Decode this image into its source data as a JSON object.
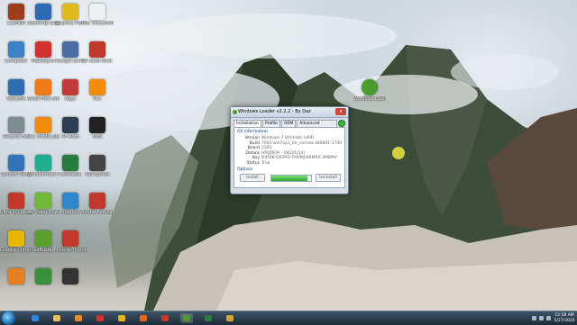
{
  "desktop": {
    "icons": [
      {
        "label": "123HDR",
        "color": "#9c3d1d",
        "col": 0,
        "row": 0
      },
      {
        "label": "Computer",
        "color": "#3b82c4",
        "col": 0,
        "row": 1
      },
      {
        "label": "Network",
        "color": "#2f6fb0",
        "col": 0,
        "row": 2
      },
      {
        "label": "Recycle Bin",
        "color": "#7f8c8d",
        "col": 0,
        "row": 3
      },
      {
        "label": "Control Panel",
        "color": "#3573b8",
        "col": 0,
        "row": 4
      },
      {
        "label": "Ultra CD Reader",
        "color": "#c0392b",
        "col": 0,
        "row": 5
      },
      {
        "label": "Google Chrome",
        "color": "#e8b800",
        "col": 0,
        "row": 6
      },
      {
        "label": "",
        "color": "#e67e22",
        "col": 0,
        "row": 7
      },
      {
        "label": "SketchUp Graphics Kit",
        "color": "#2d6bb5",
        "col": 1,
        "row": 0
      },
      {
        "label": "MEGAsync",
        "color": "#d0312d",
        "col": 1,
        "row": 1
      },
      {
        "label": "Avast Free Antivirus",
        "color": "#f07b16",
        "col": 1,
        "row": 2
      },
      {
        "label": "VLC media player",
        "color": "#f28c0f",
        "col": 1,
        "row": 3
      },
      {
        "label": "Wondershare Filmora",
        "color": "#1fae8f",
        "col": 1,
        "row": 4
      },
      {
        "label": "4K Video Downloader",
        "color": "#72b83b",
        "col": 1,
        "row": 5
      },
      {
        "label": "IsoBuster",
        "color": "#5aa02c",
        "col": 1,
        "row": 6
      },
      {
        "label": "",
        "color": "#3a8f3a",
        "col": 1,
        "row": 7
      },
      {
        "label": "Graphics PDF Tool",
        "color": "#e0b91c",
        "col": 2,
        "row": 0
      },
      {
        "label": "Google Earth",
        "color": "#4a6fa5",
        "col": 2,
        "row": 1
      },
      {
        "label": "Apps",
        "color": "#c23b3b",
        "col": 2,
        "row": 2
      },
      {
        "label": "CF-Auto",
        "color": "#2c3e50",
        "col": 2,
        "row": 3
      },
      {
        "label": "Camtasia",
        "color": "#2a7b3f",
        "col": 2,
        "row": 4
      },
      {
        "label": "KingRoot",
        "color": "#2f86c9",
        "col": 2,
        "row": 5
      },
      {
        "label": "Miracle Thunder",
        "color": "#c0392b",
        "col": 2,
        "row": 6
      },
      {
        "label": "",
        "color": "#333333",
        "col": 2,
        "row": 7
      },
      {
        "label": "Your Document",
        "color": "#ecf0f1",
        "col": 3,
        "row": 0
      },
      {
        "label": "CF-Auto-Root",
        "color": "#c0392b",
        "col": 3,
        "row": 1
      },
      {
        "label": "VLC",
        "color": "#f28c0f",
        "col": 3,
        "row": 2
      },
      {
        "label": "OBS",
        "color": "#222222",
        "col": 3,
        "row": 3
      },
      {
        "label": "ISO Burner",
        "color": "#444444",
        "col": 3,
        "row": 4
      },
      {
        "label": "Adobe Acrobat",
        "color": "#c0392b",
        "col": 3,
        "row": 5
      }
    ],
    "right_icon": {
      "label": "Windows Loader",
      "color": "#4a9c2e"
    }
  },
  "loader_window": {
    "title": "Windows Loader v2.2.2 - By Daz",
    "tabs": [
      "Installation",
      "Profile",
      "OEM",
      "Advanced options"
    ],
    "active_tab": "Installation",
    "os_info_heading": "OS information",
    "rows": [
      {
        "key": "Version",
        "value": "Windows 7 Ultimate (x64)"
      },
      {
        "key": "Build",
        "value": "7601.win7sp1_ldr_escrow.180801-1700"
      },
      {
        "key": "Board",
        "value": "2381"
      },
      {
        "key": "Details",
        "value": "HPQOEM - (06/21/14)"
      },
      {
        "key": "Key",
        "value": "D4F6K-QK3RD-TMVMJ-BBMRX-3MBMV"
      },
      {
        "key": "Status",
        "value": "Trial"
      }
    ],
    "options_heading": "Options",
    "install_label": "Install",
    "uninstall_label": "Uninstall",
    "progress": 0.9,
    "close_glyph": "x"
  },
  "taskbar": {
    "items": [
      {
        "name": "ie-icon",
        "color": "#2f86d9",
        "active": false
      },
      {
        "name": "explorer-icon",
        "color": "#e8c15a",
        "active": false
      },
      {
        "name": "media-player-icon",
        "color": "#f08a24",
        "active": false
      },
      {
        "name": "opera-icon",
        "color": "#d0312d",
        "active": false
      },
      {
        "name": "chrome-icon",
        "color": "#e8b800",
        "active": false
      },
      {
        "name": "firefox-icon",
        "color": "#e86a1c",
        "active": false
      },
      {
        "name": "app-icon",
        "color": "#c0392b",
        "active": false
      },
      {
        "name": "windows-loader-icon",
        "color": "#4a9c2e",
        "active": true
      },
      {
        "name": "camtasia-icon",
        "color": "#2a7b3f",
        "active": false
      },
      {
        "name": "folder-icon",
        "color": "#d4a43a",
        "active": false
      }
    ],
    "clock_time": "12:58 AM",
    "clock_date": "5/27/2020"
  }
}
